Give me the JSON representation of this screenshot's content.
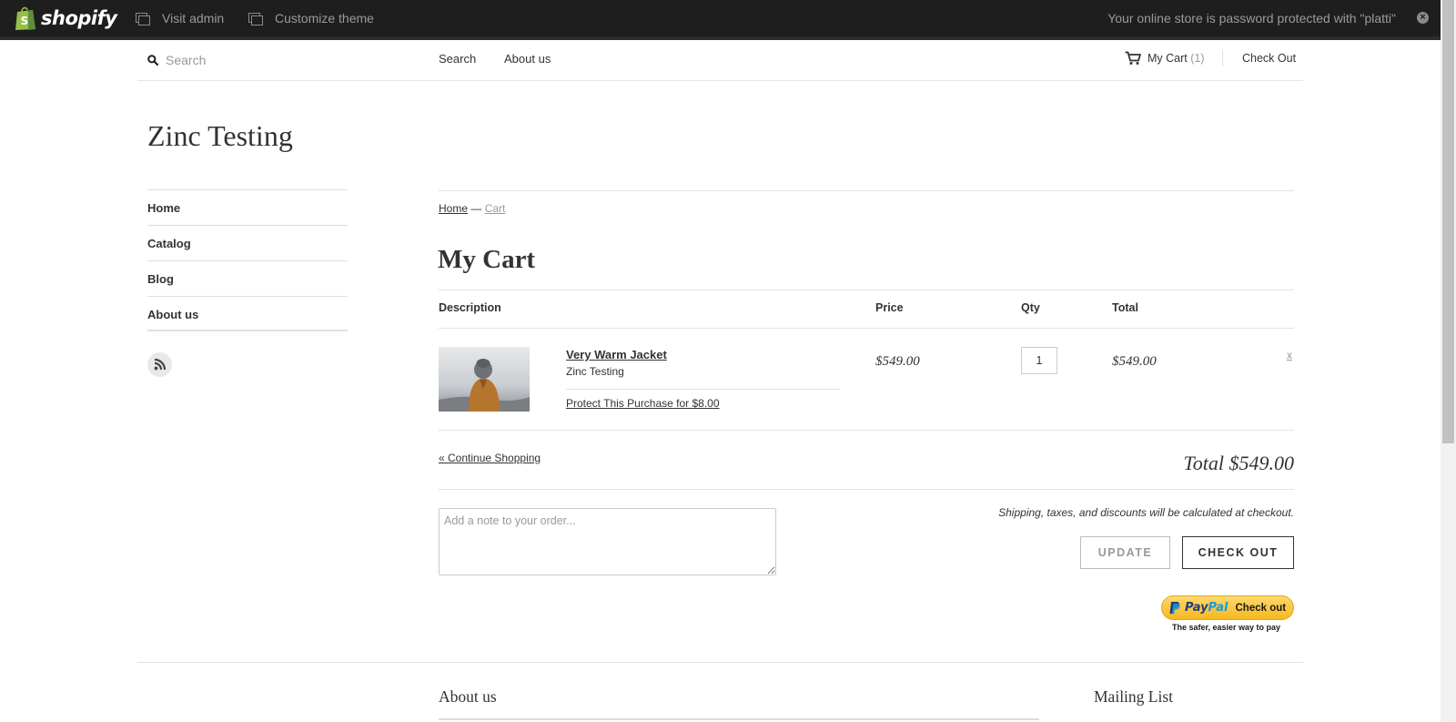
{
  "admin_bar": {
    "brand": "shopify",
    "visit_admin": "Visit admin",
    "customize_theme": "Customize theme",
    "password_notice": "Your online store is password protected with \"platti\"",
    "close_glyph": "×"
  },
  "header": {
    "search_placeholder": "Search",
    "nav": [
      "Search",
      "About us"
    ],
    "cart_label": "My Cart",
    "cart_count": "(1)",
    "checkout_label": "Check Out"
  },
  "store": {
    "title": "Zinc Testing"
  },
  "sidebar": {
    "items": [
      {
        "label": "Home"
      },
      {
        "label": "Catalog"
      },
      {
        "label": "Blog"
      },
      {
        "label": "About us"
      }
    ],
    "rss_icon": "rss-icon"
  },
  "breadcrumb": {
    "home": "Home",
    "separator": "—",
    "current": "Cart"
  },
  "cart": {
    "title": "My Cart",
    "columns": {
      "description": "Description",
      "price": "Price",
      "qty": "Qty",
      "total": "Total"
    },
    "items": [
      {
        "name": "Very Warm Jacket",
        "vendor": "Zinc Testing",
        "protect": "Protect This Purchase for $8.00",
        "price": "$549.00",
        "qty": "1",
        "line_total": "$549.00",
        "remove": "x"
      }
    ],
    "continue": "« Continue Shopping",
    "total": "Total $549.00",
    "note_placeholder": "Add a note to your order...",
    "shipping_note": "Shipping, taxes, and discounts will be calculated at checkout.",
    "update_button": "UPDATE",
    "checkout_button": "CHECK OUT",
    "paypal": {
      "pay": "Pay",
      "pal": "Pal",
      "check_out": "Check out",
      "tagline": "The safer, easier way to pay"
    }
  },
  "footer": {
    "about_heading": "About us",
    "mailing_heading": "Mailing List"
  },
  "colors": {
    "admin_bar": "#1e1e1e",
    "text": "#333333",
    "muted": "#999999",
    "paypal_yellow": "#f6b81e",
    "paypal_blue": "#253b80"
  }
}
